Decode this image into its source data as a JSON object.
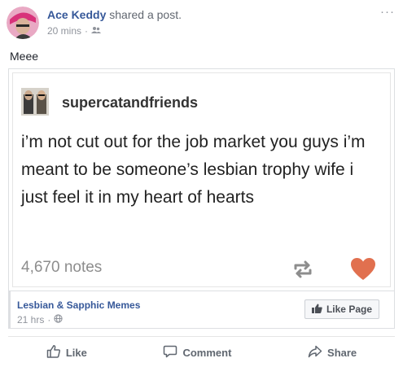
{
  "header": {
    "author": "Ace Keddy",
    "shared_text": "shared a post.",
    "time": "20 mins",
    "more_label": "···"
  },
  "post": {
    "text": "Meee"
  },
  "tumblr": {
    "username": "supercatandfriends",
    "body": "i’m not cut out for the job market you guys i’m meant to be someone’s lesbian trophy wife i just feel it in my heart of hearts",
    "notes": "4,670 notes",
    "heart_color": "#e1704f"
  },
  "attribution": {
    "page_name": "Lesbian & Sapphic Memes",
    "time": "21 hrs",
    "like_page_label": "Like Page"
  },
  "actions": {
    "like": "Like",
    "comment": "Comment",
    "share": "Share"
  },
  "colors": {
    "link": "#365899",
    "meta": "#90949c"
  }
}
